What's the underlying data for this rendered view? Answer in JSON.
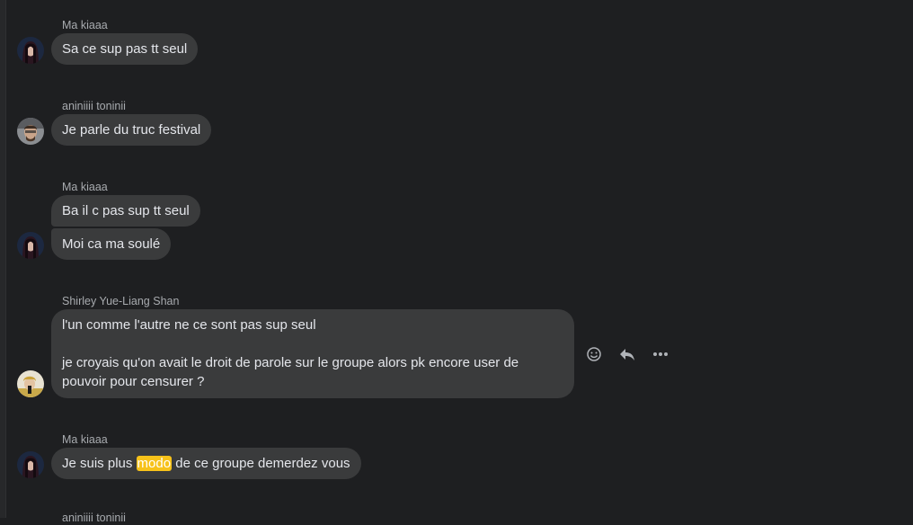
{
  "messages": [
    {
      "sender": "Ma kiaaa",
      "texts": [
        "Sa ce sup pas tt seul"
      ]
    },
    {
      "sender": "aniniiii toninii",
      "texts": [
        "Je parle du truc festival"
      ]
    },
    {
      "sender": "Ma kiaaa",
      "texts": [
        "Ba il c pas sup tt seul",
        "Moi ca ma soulé"
      ]
    },
    {
      "sender": "Shirley Yue-Liang Shan",
      "paragraphs": [
        "l'un comme l'autre ne ce sont pas sup seul",
        "je croyais qu'on avait le droit de parole sur le groupe alors pk encore user de pouvoir pour censurer ?"
      ]
    },
    {
      "sender": "Ma kiaaa",
      "text_before": "Je suis plus ",
      "highlight": "modo",
      "text_after": " de ce groupe demerdez vous"
    }
  ],
  "next_sender_partial": "aniniiii toninii",
  "actions": [
    "react-icon",
    "reply-icon",
    "more-icon"
  ],
  "colors": {
    "background": "#1e1f21",
    "bubble": "#3a3b3c",
    "highlight": "#f7c21a",
    "muted": "#a8abaf"
  }
}
